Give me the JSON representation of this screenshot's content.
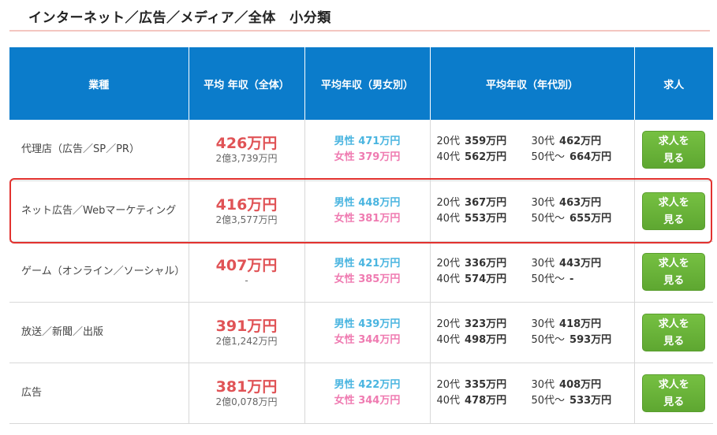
{
  "title": "インターネット／広告／メディア／全体　小分類",
  "headers": {
    "industry": "業種",
    "avg_all": "平均 年収（全体）",
    "avg_gender": "平均年収（男女別）",
    "avg_age": "平均年収（年代別）",
    "jobs": "求人"
  },
  "labels": {
    "male": "男性",
    "female": "女性",
    "age20": "20代",
    "age30": "30代",
    "age40": "40代",
    "age50": "50代～",
    "job_line1": "求人を",
    "job_line2": "見る"
  },
  "rows": [
    {
      "industry": "代理店（広告／SP／PR）",
      "avg": "426万円",
      "total": "2億3,739万円",
      "male": "471万円",
      "female": "379万円",
      "a20": "359万円",
      "a30": "462万円",
      "a40": "562万円",
      "a50": "664万円"
    },
    {
      "industry": "ネット広告／Webマーケティング",
      "avg": "416万円",
      "total": "2億3,577万円",
      "male": "448万円",
      "female": "381万円",
      "a20": "367万円",
      "a30": "463万円",
      "a40": "553万円",
      "a50": "655万円",
      "highlighted": true
    },
    {
      "industry": "ゲーム（オンライン／ソーシャル）",
      "avg": "407万円",
      "total": "-",
      "male": "421万円",
      "female": "385万円",
      "a20": "336万円",
      "a30": "443万円",
      "a40": "574万円",
      "a50": "-"
    },
    {
      "industry": "放送／新聞／出版",
      "avg": "391万円",
      "total": "2億1,242万円",
      "male": "439万円",
      "female": "344万円",
      "a20": "323万円",
      "a30": "418万円",
      "a40": "498万円",
      "a50": "593万円"
    },
    {
      "industry": "広告",
      "avg": "381万円",
      "total": "2億0,078万円",
      "male": "422万円",
      "female": "344万円",
      "a20": "335万円",
      "a30": "408万円",
      "a40": "478万円",
      "a50": "533万円"
    }
  ],
  "colors": {
    "header_bg": "#0b7ccb",
    "avg_red": "#e05356",
    "male_blue": "#4ab5e0",
    "female_pink": "#ef7bb1",
    "button_green": "#6bb43a",
    "highlight_red": "#e2322f"
  }
}
